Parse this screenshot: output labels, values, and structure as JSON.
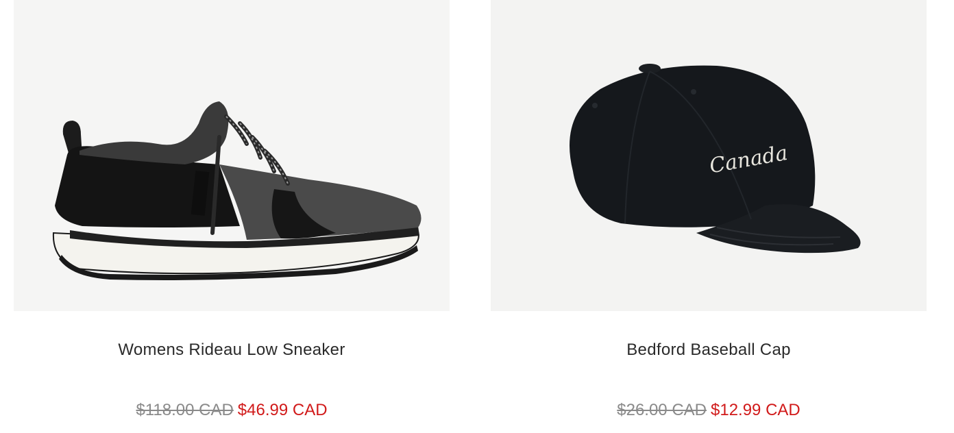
{
  "products": [
    {
      "title": "Womens Rideau Low Sneaker",
      "price_original": "$118.00 CAD",
      "price_sale": "$46.99 CAD",
      "image_icon": "sneaker-image"
    },
    {
      "title": "Bedford Baseball Cap",
      "price_original": "$26.00 CAD",
      "price_sale": "$12.99 CAD",
      "image_icon": "cap-image",
      "image_embroidery": "Canada"
    }
  ],
  "colors": {
    "sale_price": "#d11a1a",
    "original_price": "#8a8a8a",
    "title": "#2a2a2a",
    "image_background": "#f5f5f4"
  }
}
